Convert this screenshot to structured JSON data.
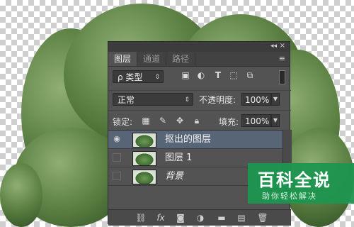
{
  "tabs": [
    {
      "label": "图层",
      "active": true
    },
    {
      "label": "通道",
      "active": false
    },
    {
      "label": "路径",
      "active": false
    }
  ],
  "filter": {
    "label": "ρ 类型"
  },
  "filter_icons": [
    "image-icon",
    "adjustment-circle-icon",
    "type-T-icon",
    "shape-icon",
    "smart-object-icon"
  ],
  "blend": {
    "mode": "正常",
    "opacity_label": "不透明度:",
    "opacity_value": "100%"
  },
  "lock": {
    "label": "锁定:",
    "fill_label": "填充:",
    "fill_value": "100%"
  },
  "layers": [
    {
      "name": "抠出的图层",
      "visible": true,
      "selected": true,
      "italic": false
    },
    {
      "name": "图层 1",
      "visible": false,
      "selected": false,
      "italic": false
    },
    {
      "name": "背景",
      "visible": false,
      "selected": false,
      "italic": true
    }
  ],
  "bottom_icons": [
    "link-icon",
    "fx-icon",
    "mask-icon",
    "adjustment-icon",
    "folder-icon",
    "new-layer-icon",
    "trash-icon"
  ],
  "watermark": {
    "title": "百科全说",
    "subtitle": "助你轻松解决"
  },
  "colors": {
    "panel": "#535353",
    "selected_layer": "#586577",
    "watermark": "#1e9650"
  }
}
